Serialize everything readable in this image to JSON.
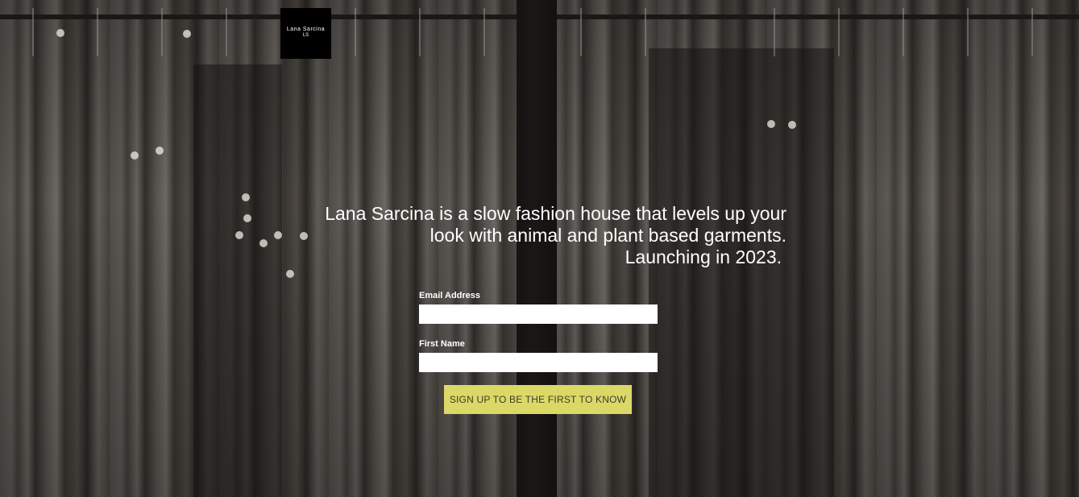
{
  "brand": {
    "logo_name": "Lana Sarcina",
    "logo_mark": "LS"
  },
  "hero": {
    "line1": "Lana Sarcina is a slow fashion house that levels up your",
    "line2": "look with animal and plant based garments.",
    "line3": "Launching in 2023."
  },
  "form": {
    "email_label": "Email Address",
    "email_value": "",
    "first_name_label": "First Name",
    "first_name_value": "",
    "submit_label": "SIGN UP TO BE THE FIRST TO KNOW"
  },
  "colors": {
    "button_bg": "#dcd866",
    "overlay": "#1e1b19",
    "text": "#ffffff"
  }
}
